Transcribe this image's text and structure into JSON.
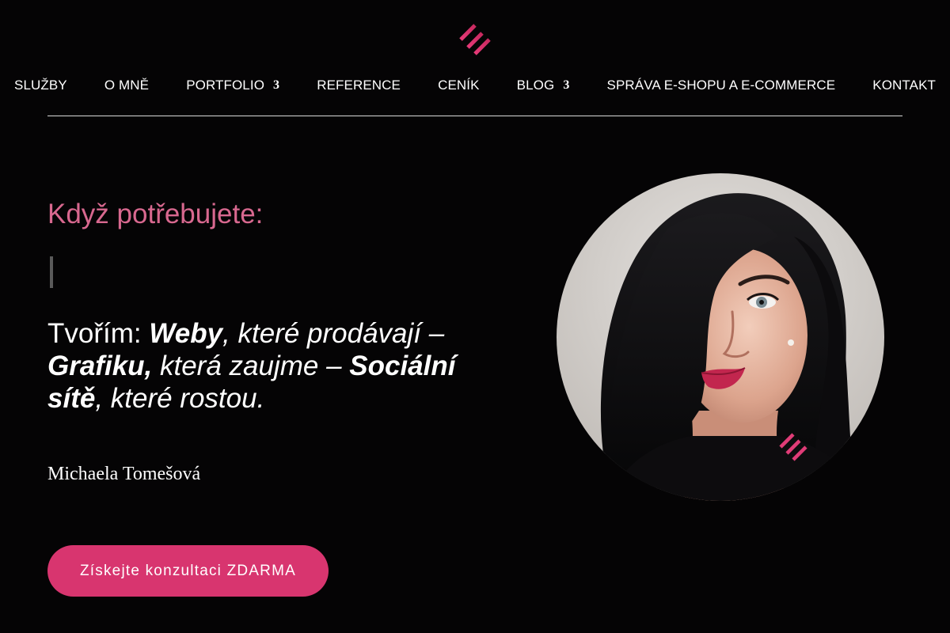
{
  "brand": {
    "logo_icon": "three-slash-stripes-icon",
    "accent_color": "#d8356f",
    "kicker_color": "#d8688f"
  },
  "nav": {
    "items": [
      {
        "label": "SLUŽBY"
      },
      {
        "label": "O MNĚ"
      },
      {
        "label": "PORTFOLIO",
        "caret": "3"
      },
      {
        "label": "REFERENCE"
      },
      {
        "label": "CENÍK"
      },
      {
        "label": "BLOG",
        "caret": "3"
      },
      {
        "label": "SPRÁVA E-SHOPU A E-COMMERCE"
      },
      {
        "label": "KONTAKT"
      }
    ]
  },
  "hero": {
    "kicker": "Když potřebujete:",
    "tagline": {
      "lead": "Tvořím: ",
      "item1": "Weby",
      "rest1": ", které prodávají –",
      "item2": "Grafiku,",
      "rest2": " která zaujme – ",
      "item3a": "Sociální",
      "item3b": "sítě",
      "rest3": ", které rostou."
    },
    "signature": "Michaela Tomešová",
    "cta_label": "Získejte konzultaci ZDARMA"
  },
  "portrait": {
    "icon": "woman-portrait-photo"
  }
}
